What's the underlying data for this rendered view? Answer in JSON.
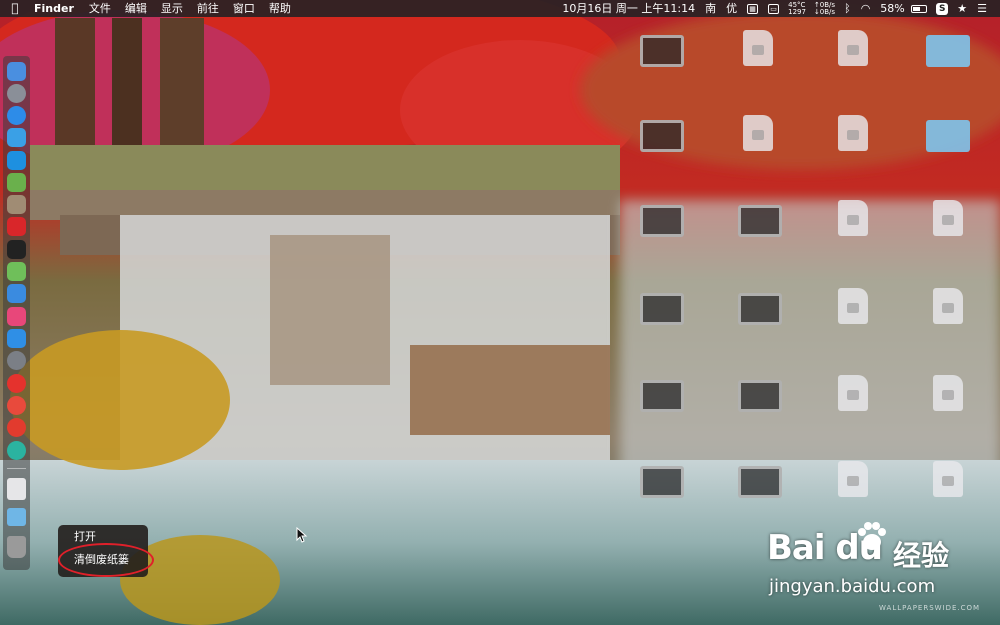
{
  "menubar": {
    "apple_icon": "apple-logo",
    "app_name": "Finder",
    "menus": [
      "文件",
      "编辑",
      "显示",
      "前往",
      "窗口",
      "帮助"
    ],
    "datetime": "10月16日 周一 上午11:14",
    "input_method_1": "南",
    "input_method_2": "优",
    "temperature": "45°C",
    "fan_speed": "1297",
    "net_up": "↑0B/s",
    "net_down": "↓0B/s",
    "battery_percent": "58%",
    "battery_level": 0.58
  },
  "dock": {
    "icons": [
      {
        "name": "finder-icon",
        "color": "#4a8fe0"
      },
      {
        "name": "launchpad-icon",
        "color": "#8a8f98"
      },
      {
        "name": "safari-icon",
        "color": "#2d8ce8"
      },
      {
        "name": "preview-icon",
        "color": "#3aa0e6"
      },
      {
        "name": "teamviewer-icon",
        "color": "#1e90e0"
      },
      {
        "name": "android-icon",
        "color": "#6ab04c"
      },
      {
        "name": "photos-icon",
        "color": "#a08c74"
      },
      {
        "name": "app-red-icon",
        "color": "#d9262a"
      },
      {
        "name": "terminal-icon",
        "color": "#222222"
      },
      {
        "name": "maps-icon",
        "color": "#6fbf5a"
      },
      {
        "name": "siri-icon",
        "color": "#3a8be0"
      },
      {
        "name": "itunes-icon",
        "color": "#e8477a"
      },
      {
        "name": "app-store-icon",
        "color": "#2f8fe6"
      },
      {
        "name": "system-preferences-icon",
        "color": "#7b7f86"
      },
      {
        "name": "yandex-browser-icon",
        "color": "#e5322d"
      },
      {
        "name": "chrome-icon",
        "color": "#e84a3c"
      },
      {
        "name": "weibo-icon",
        "color": "#e23b2e"
      },
      {
        "name": "app-teal-icon",
        "color": "#2bb3a0"
      }
    ],
    "bottom_icons": [
      {
        "name": "document-icon",
        "color": "#e6e6e8"
      },
      {
        "name": "downloads-folder-icon",
        "color": "#6fb6e6"
      },
      {
        "name": "trash-icon",
        "color": "#9a9a9a"
      }
    ]
  },
  "context_menu": {
    "items": [
      "打开",
      "清倒废纸篓"
    ]
  },
  "watermark": {
    "logo": "Bai du",
    "logo_cn": "经验",
    "url": "jingyan.baidu.com",
    "small": "WALLPAPERSWIDE.COM"
  }
}
